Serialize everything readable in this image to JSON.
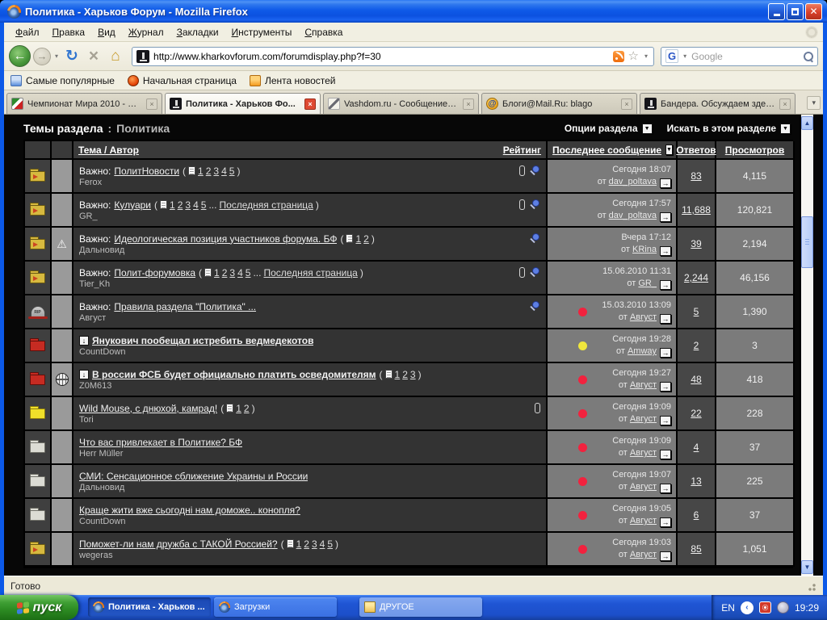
{
  "window": {
    "title": "Политика - Харьков Форум - Mozilla Firefox"
  },
  "menu": {
    "items": [
      "Файл",
      "Правка",
      "Вид",
      "Журнал",
      "Закладки",
      "Инструменты",
      "Справка"
    ]
  },
  "navbar": {
    "url": "http://www.kharkovforum.com/forumdisplay.php?f=30",
    "search_placeholder": "Google",
    "search_engine": "G"
  },
  "bookmarks": [
    {
      "label": "Самые популярные",
      "icon": "popular"
    },
    {
      "label": "Начальная страница",
      "icon": "firefox-home"
    },
    {
      "label": "Лента новостей",
      "icon": "feed"
    }
  ],
  "tabs": [
    {
      "label": "Чемпионат Мира 2010 - Ар...",
      "icon": "flag",
      "active": false
    },
    {
      "label": "Политика - Харьков Фо...",
      "icon": "monument",
      "active": true
    },
    {
      "label": "Vashdom.ru - Сообщение в...",
      "icon": "pen",
      "active": false
    },
    {
      "label": "Блоги@Mail.Ru: blago",
      "icon": "mailru",
      "active": false
    },
    {
      "label": "Бандера. Обсуждаем здес...",
      "icon": "monument",
      "active": false
    }
  ],
  "forum": {
    "section_title": "Темы раздела",
    "section_sep": ":",
    "section_name": "Политика",
    "options_label": "Опции раздела",
    "search_label": "Искать в этом разделе",
    "from_label": "от",
    "ellipsis_label": "...",
    "columns": {
      "topic": "Тема / Автор",
      "rating": "Рейтинг",
      "last": "Последнее сообщение",
      "replies": "Ответов",
      "views": "Просмотров"
    },
    "icons": {
      "tombstone_text": "RIP",
      "mailru_glyph": "@"
    },
    "rows": [
      {
        "folder": "yellow-arrow",
        "status": "",
        "prefix": "Важно:",
        "unread": false,
        "bold": false,
        "title": "ПолитНовости",
        "pages": [
          "1",
          "2",
          "3",
          "4",
          "5"
        ],
        "pages_last": "",
        "author": "Ferox",
        "clip": true,
        "pin": true,
        "last_date": "Сегодня 18:07",
        "last_user": "dav_poltava",
        "dot": "",
        "replies": "83",
        "views": "4,115"
      },
      {
        "folder": "yellow-arrow",
        "status": "",
        "prefix": "Важно:",
        "unread": false,
        "bold": false,
        "title": "Кулуари",
        "pages": [
          "1",
          "2",
          "3",
          "4",
          "5"
        ],
        "pages_last": "Последняя страница",
        "author": "GR_",
        "clip": true,
        "pin": true,
        "last_date": "Сегодня 17:57",
        "last_user": "dav_poltava",
        "dot": "",
        "replies": "11,688",
        "views": "120,821"
      },
      {
        "folder": "yellow-arrow",
        "status": "warning",
        "prefix": "Важно:",
        "unread": false,
        "bold": false,
        "title": "Идеологическая позиция участников форума. БФ",
        "pages": [
          "1",
          "2"
        ],
        "pages_last": "",
        "author": "Дальновид",
        "clip": false,
        "pin": true,
        "last_date": "Вчера 17:12",
        "last_user": "KRina",
        "dot": "",
        "replies": "39",
        "views": "2,194"
      },
      {
        "folder": "yellow-arrow",
        "status": "",
        "prefix": "Важно:",
        "unread": false,
        "bold": false,
        "title": "Полит-форумовка",
        "pages": [
          "1",
          "2",
          "3",
          "4",
          "5"
        ],
        "pages_last": "Последняя страница",
        "author": "Tier_Kh",
        "clip": true,
        "pin": true,
        "last_date": "15.06.2010 11:31",
        "last_user": "GR_",
        "dot": "",
        "replies": "2,244",
        "views": "46,156"
      },
      {
        "folder": "tombstone",
        "status": "",
        "prefix": "Важно:",
        "unread": false,
        "bold": false,
        "title": "Правила раздела \"Политика\" ...",
        "pages": [],
        "pages_last": "",
        "author": "Август",
        "clip": false,
        "pin": true,
        "last_date": "15.03.2010 13:09",
        "last_user": "Август",
        "dot": "red",
        "replies": "5",
        "views": "1,390"
      },
      {
        "folder": "red",
        "status": "",
        "prefix": "",
        "unread": true,
        "bold": true,
        "title": "Янукович пообещал истребить ведмедекотов",
        "pages": [],
        "pages_last": "",
        "author": "CountDown",
        "clip": false,
        "pin": false,
        "last_date": "Сегодня 19:28",
        "last_user": "Amway",
        "dot": "yellow",
        "replies": "2",
        "views": "3"
      },
      {
        "folder": "red",
        "status": "globe",
        "prefix": "",
        "unread": true,
        "bold": true,
        "title": "В россии ФСБ будет официально платить осведомителям",
        "pages": [
          "1",
          "2",
          "3"
        ],
        "pages_last": "",
        "author": "Z0M613",
        "clip": false,
        "pin": false,
        "last_date": "Сегодня 19:27",
        "last_user": "Август",
        "dot": "red",
        "replies": "48",
        "views": "418"
      },
      {
        "folder": "yellow",
        "status": "",
        "prefix": "",
        "unread": false,
        "bold": false,
        "title": "Wild Mouse, с днюхой, камрад!",
        "pages": [
          "1",
          "2"
        ],
        "pages_last": "",
        "author": "Tori",
        "clip": true,
        "pin": false,
        "last_date": "Сегодня 19:09",
        "last_user": "Август",
        "dot": "red",
        "replies": "22",
        "views": "228"
      },
      {
        "folder": "gray",
        "status": "",
        "prefix": "",
        "unread": false,
        "bold": false,
        "title": "Что вас привлекает в Политике? БФ",
        "pages": [],
        "pages_last": "",
        "author": "Herr Müller",
        "clip": false,
        "pin": false,
        "last_date": "Сегодня 19:09",
        "last_user": "Август",
        "dot": "red",
        "replies": "4",
        "views": "37"
      },
      {
        "folder": "gray",
        "status": "",
        "prefix": "",
        "unread": false,
        "bold": false,
        "title": "СМИ: Сенсационное сближение Украины и России",
        "pages": [],
        "pages_last": "",
        "author": "Дальновид",
        "clip": false,
        "pin": false,
        "last_date": "Сегодня 19:07",
        "last_user": "Август",
        "dot": "red",
        "replies": "13",
        "views": "225"
      },
      {
        "folder": "gray",
        "status": "",
        "prefix": "",
        "unread": false,
        "bold": false,
        "title": "Краще жити вже сьогодні нам доможе.. конопля?",
        "pages": [],
        "pages_last": "",
        "author": "CountDown",
        "clip": false,
        "pin": false,
        "last_date": "Сегодня 19:05",
        "last_user": "Август",
        "dot": "red",
        "replies": "6",
        "views": "37"
      },
      {
        "folder": "yellow-arrow",
        "status": "",
        "prefix": "",
        "unread": false,
        "bold": false,
        "title": "Поможет-ли нам дружба с ТАКОЙ Россией?",
        "pages": [
          "1",
          "2",
          "3",
          "4",
          "5"
        ],
        "pages_last": "",
        "author": "wegeras",
        "clip": false,
        "pin": false,
        "last_date": "Сегодня 19:03",
        "last_user": "Август",
        "dot": "red",
        "replies": "85",
        "views": "1,051"
      }
    ]
  },
  "statusbar": {
    "text": "Готово"
  },
  "taskbar": {
    "start_label": "пуск",
    "tasks": [
      {
        "label": "Политика - Харьков ...",
        "icon": "firefox",
        "active": true,
        "light": false
      },
      {
        "label": "Загрузки",
        "icon": "firefox",
        "active": false,
        "light": false
      },
      {
        "label": "ДРУГОЕ",
        "icon": "folder",
        "active": false,
        "light": true
      }
    ],
    "tray": {
      "lang": "EN",
      "time": "19:29"
    }
  },
  "colors": {
    "new_dot_red": "#f2223e",
    "new_dot_yellow": "#f0e63c",
    "taskbar_blue": "#1f55d4",
    "start_green": "#2c8a22"
  }
}
